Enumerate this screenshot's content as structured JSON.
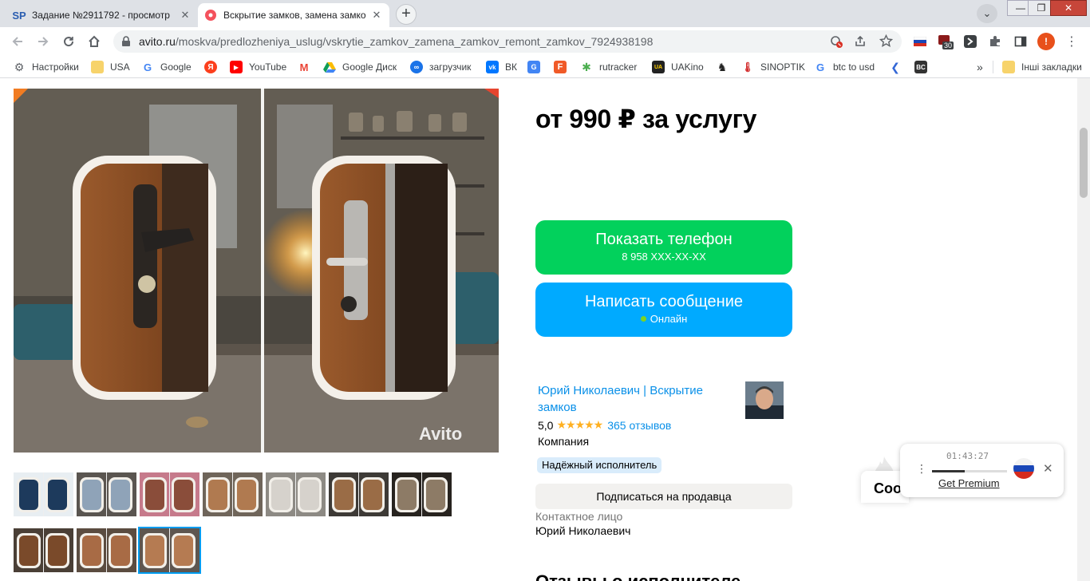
{
  "tabs": [
    {
      "favicon_text": "SP",
      "title": "Задание №2911792 - просмотр",
      "close": "✕"
    },
    {
      "favicon_text": "",
      "title": "Вскрытие замков, замена замков",
      "close": "✕"
    }
  ],
  "new_tab": "+",
  "tab_dropdown": "⌄",
  "window": {
    "minimize": "—",
    "maximize": "❐",
    "close": "✕"
  },
  "omnibox": {
    "host": "avito.ru",
    "path": "/moskva/predlozheniya_uslug/vskrytie_zamkov_zamena_zamkov_remont_zamkov_7924938198"
  },
  "extension_badge": "30",
  "profile_letter": "!",
  "bookmarks": [
    {
      "label": "Настройки",
      "icon": "gear-icon"
    },
    {
      "label": "USA",
      "icon": "folder-icon"
    },
    {
      "label": "Google",
      "icon": "google-icon"
    },
    {
      "label": "",
      "icon": "yandex-icon"
    },
    {
      "label": "YouTube",
      "icon": "youtube-icon"
    },
    {
      "label": "",
      "icon": "gmail-icon"
    },
    {
      "label": "Google Диск",
      "icon": "drive-icon"
    },
    {
      "label": "загрузчик",
      "icon": "loader-icon"
    },
    {
      "label": "ВК",
      "icon": "vk-icon"
    },
    {
      "label": "",
      "icon": "translate-icon"
    },
    {
      "label": "",
      "icon": "f-icon"
    },
    {
      "label": "rutracker",
      "icon": "rutracker-icon"
    },
    {
      "label": "UAKino",
      "icon": "uakino-icon"
    },
    {
      "label": "",
      "icon": "chess-icon"
    },
    {
      "label": "SINOPTIK",
      "icon": "thermometer-icon"
    },
    {
      "label": "btc to usd",
      "icon": "google-icon"
    },
    {
      "label": "",
      "icon": "arrow-icon"
    },
    {
      "label": "",
      "icon": "bc-icon"
    }
  ],
  "bookmarks_more": "»",
  "other_bookmarks": "Інші закладки",
  "listing": {
    "price": "от 990 ₽ за услугу",
    "phone_button": {
      "label": "Показать телефон",
      "sub": "8 958 XXX-XX-XX"
    },
    "message_button": {
      "label": "Написать сообщение",
      "sub": "Онлайн"
    },
    "watermark": "Avito",
    "thumbnail_count": 10,
    "selected_thumbnail": 10
  },
  "seller": {
    "name": "Юрий Николаевич | Вскрытие замков",
    "rating": "5,0",
    "stars": "★★★★★",
    "rating_value": 5,
    "reviews": "365 отзывов",
    "type": "Компания",
    "badge": "Надёжный исполнитель",
    "subscribe_button": "Подписаться на продавца",
    "contact_label": "Контактное лицо",
    "contact_name": "Юрий Николаевич"
  },
  "section_title": "Отзывы о исполнителе",
  "chat_widget_text": "Соо",
  "vpn_popup": {
    "timer": "01:43:27",
    "premium_link": "Get Premium",
    "progress": 0.44,
    "close": "✕"
  },
  "colors": {
    "phone_green": "#02d15c",
    "message_blue": "#00aaff",
    "link_blue": "#0a90e8",
    "star": "#ffb021",
    "badge_bg": "#d9ecfb"
  }
}
